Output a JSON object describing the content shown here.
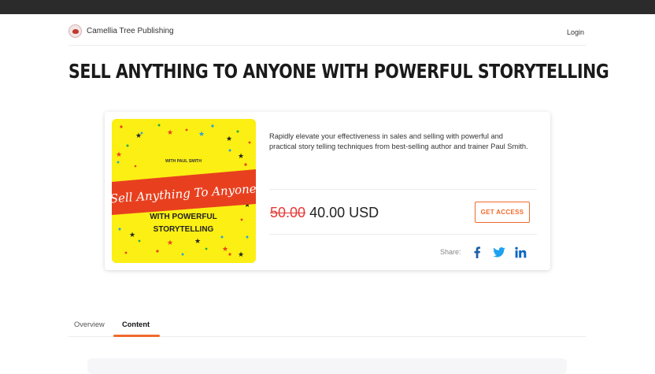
{
  "header": {
    "brand_name": "Camellia Tree Publishing",
    "login_label": "Login"
  },
  "page_title": "SELL ANYTHING TO ANYONE WITH POWERFUL STORYTELLING",
  "product": {
    "cover": {
      "byline": "WITH PAUL SMITH",
      "banner_text": "Sell Anything To Anyone",
      "subtitle_line1": "WITH POWERFUL",
      "subtitle_line2": "STORYTELLING",
      "colors": {
        "background": "#fbef14",
        "banner": "#e8401f"
      }
    },
    "description": "Rapidly elevate your effectiveness in sales and selling with powerful and practical story telling techniques from best-selling author and trainer Paul Smith.",
    "old_price": "50.00",
    "new_price": "40.00 USD",
    "cta_label": "GET ACCESS",
    "share_label": "Share:",
    "share_icons": [
      "facebook-icon",
      "twitter-icon",
      "linkedin-icon"
    ]
  },
  "tabs": [
    {
      "label": "Overview"
    },
    {
      "label": "Content",
      "active": true
    }
  ],
  "colors": {
    "accent": "#f06a2c",
    "strike": "#e53935",
    "facebook": "#1d5fa8",
    "twitter": "#1da1f2",
    "linkedin": "#0a66c2"
  }
}
